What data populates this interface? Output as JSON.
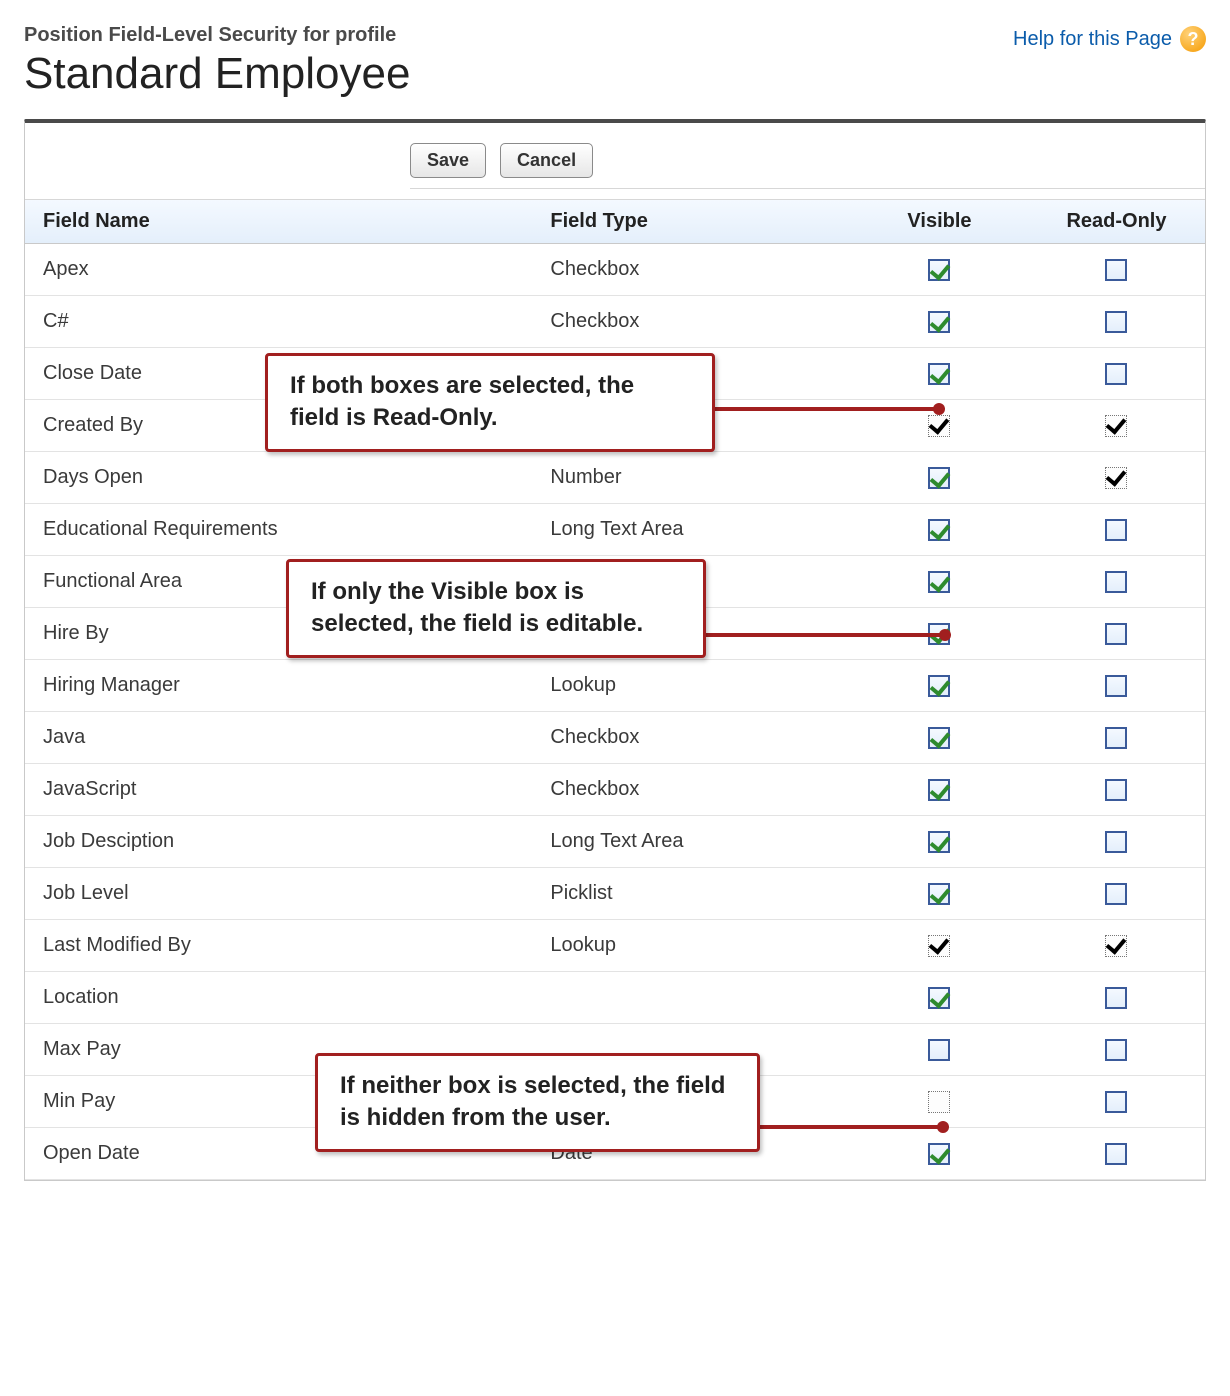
{
  "header": {
    "subtitle": "Position Field-Level Security for profile",
    "title": "Standard Employee",
    "help_label": "Help for this Page"
  },
  "buttons": {
    "save": "Save",
    "cancel": "Cancel"
  },
  "columns": {
    "field_name": "Field Name",
    "field_type": "Field Type",
    "visible": "Visible",
    "read_only": "Read-Only"
  },
  "rows": [
    {
      "name": "Apex",
      "type": "Checkbox",
      "visible": "checked",
      "readonly": "unchecked"
    },
    {
      "name": "C#",
      "type": "Checkbox",
      "visible": "checked",
      "readonly": "unchecked"
    },
    {
      "name": "Close Date",
      "type": "",
      "visible": "checked",
      "readonly": "unchecked"
    },
    {
      "name": "Created By",
      "type": "",
      "visible": "locked",
      "readonly": "locked"
    },
    {
      "name": "Days Open",
      "type": "Number",
      "visible": "checked",
      "readonly": "locked"
    },
    {
      "name": "Educational Requirements",
      "type": "Long Text Area",
      "visible": "checked",
      "readonly": "unchecked"
    },
    {
      "name": "Functional Area",
      "type": "",
      "visible": "checked",
      "readonly": "unchecked"
    },
    {
      "name": "Hire By",
      "type": "",
      "visible": "checked",
      "readonly": "unchecked"
    },
    {
      "name": "Hiring Manager",
      "type": "Lookup",
      "visible": "checked",
      "readonly": "unchecked"
    },
    {
      "name": "Java",
      "type": "Checkbox",
      "visible": "checked",
      "readonly": "unchecked"
    },
    {
      "name": "JavaScript",
      "type": "Checkbox",
      "visible": "checked",
      "readonly": "unchecked"
    },
    {
      "name": "Job Desciption",
      "type": "Long Text Area",
      "visible": "checked",
      "readonly": "unchecked"
    },
    {
      "name": "Job Level",
      "type": "Picklist",
      "visible": "checked",
      "readonly": "unchecked"
    },
    {
      "name": "Last Modified By",
      "type": "Lookup",
      "visible": "locked",
      "readonly": "locked"
    },
    {
      "name": "Location",
      "type": "",
      "visible": "checked",
      "readonly": "unchecked"
    },
    {
      "name": "Max Pay",
      "type": "",
      "visible": "unchecked",
      "readonly": "unchecked"
    },
    {
      "name": "Min Pay",
      "type": "",
      "visible": "disabled-empty",
      "readonly": "unchecked"
    },
    {
      "name": "Open Date",
      "type": "Date",
      "visible": "checked",
      "readonly": "unchecked"
    }
  ],
  "callouts": {
    "both": "If both boxes are selected, the field is Read-Only.",
    "visible": "If only the Visible box is selected, the field is editable.",
    "neither": "If neither box is selected, the field is hidden from the user."
  }
}
